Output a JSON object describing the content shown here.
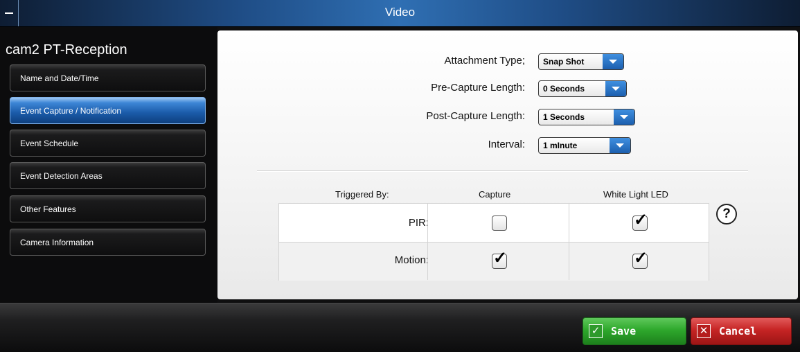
{
  "window": {
    "title": "Video"
  },
  "sidebar": {
    "camera_name": "cam2 PT-Reception",
    "items": [
      {
        "label": "Name and Date/Time"
      },
      {
        "label": "Event Capture / Notification",
        "active": true
      },
      {
        "label": "Event Schedule"
      },
      {
        "label": "Event Detection Areas"
      },
      {
        "label": "Other Features"
      },
      {
        "label": "Camera Information"
      }
    ]
  },
  "settings": {
    "attachment_type": {
      "label": "Attachment Type;",
      "value": "Snap Shot"
    },
    "pre_capture": {
      "label": "Pre-Capture Length:",
      "value": "0 Seconds"
    },
    "post_capture": {
      "label": "Post-Capture Length:",
      "value": "1 Seconds"
    },
    "interval": {
      "label": "Interval:",
      "value": "1 mInute"
    }
  },
  "triggers": {
    "headers": {
      "triggered_by": "Triggered By:",
      "capture": "Capture",
      "led": "White Light LED"
    },
    "rows": [
      {
        "label": "PIR:",
        "capture": false,
        "led": true
      },
      {
        "label": "Motion:",
        "capture": true,
        "led": true
      }
    ]
  },
  "help": {
    "glyph": "?"
  },
  "footer": {
    "save_label": "Save",
    "cancel_label": "Cancel"
  },
  "colors": {
    "accent": "#1f63b4",
    "save": "#2ea82c",
    "cancel": "#c62424"
  }
}
